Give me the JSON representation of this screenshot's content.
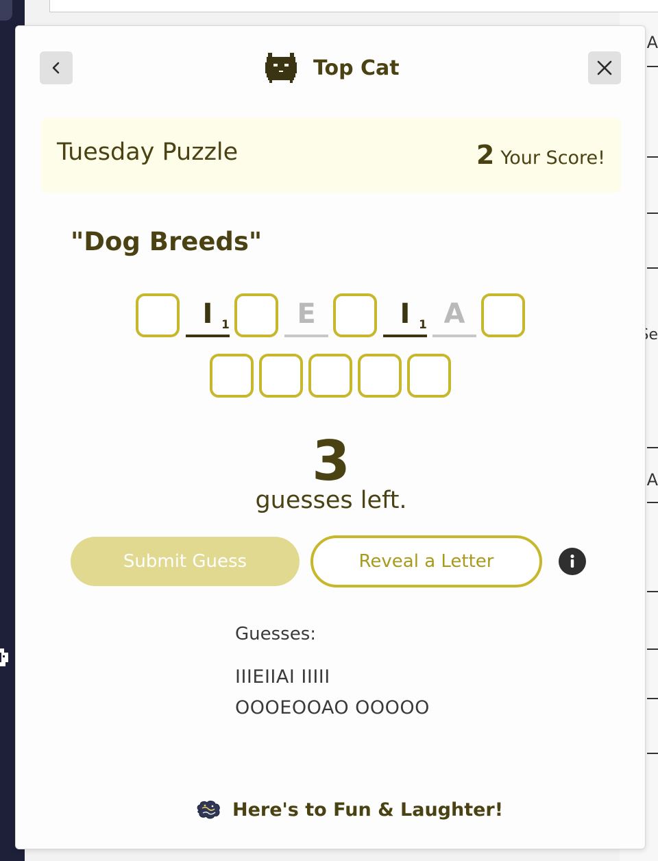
{
  "app": {
    "title": "Top Cat",
    "back_icon": "chevron-left-icon",
    "close_icon": "close-icon",
    "logo_icon": "pixel-cat-icon"
  },
  "puzzle": {
    "day": "Tuesday Puzzle",
    "score_value": "2",
    "score_label": "Your Score!",
    "category": "\"Dog Breeds\""
  },
  "board": {
    "word1": [
      {
        "letter": "",
        "sub": "",
        "state": "empty"
      },
      {
        "letter": "I",
        "sub": "1",
        "state": "dark"
      },
      {
        "letter": "",
        "sub": "",
        "state": "empty"
      },
      {
        "letter": "E",
        "sub": "",
        "state": "gray"
      },
      {
        "letter": "",
        "sub": "",
        "state": "empty"
      },
      {
        "letter": "I",
        "sub": "1",
        "state": "dark"
      },
      {
        "letter": "A",
        "sub": "",
        "state": "gray"
      },
      {
        "letter": "",
        "sub": "",
        "state": "empty"
      }
    ],
    "word2": [
      {
        "letter": "",
        "sub": "",
        "state": "empty"
      },
      {
        "letter": "",
        "sub": "",
        "state": "empty"
      },
      {
        "letter": "",
        "sub": "",
        "state": "empty"
      },
      {
        "letter": "",
        "sub": "",
        "state": "empty"
      },
      {
        "letter": "",
        "sub": "",
        "state": "empty"
      }
    ]
  },
  "status": {
    "guesses_left_count": "3",
    "guesses_left_label": "guesses left."
  },
  "actions": {
    "submit_label": "Submit Guess",
    "reveal_label": "Reveal a Letter",
    "info_icon": "info-icon"
  },
  "history": {
    "heading": "Guesses:",
    "items": [
      "IIIEIIAI IIIII",
      "OOOEOOAO OOOOO"
    ]
  },
  "footer": {
    "text": "Here's to Fun & Laughter!",
    "icon": "brain-icon"
  },
  "colors": {
    "brand": "#4a4213",
    "tile_border": "#c7b72c",
    "submit_bg": "#e1d98f",
    "banner_bg": "#fefde9",
    "gray_letter": "#b9b9b9"
  },
  "background": {
    "right_fragments": [
      "A",
      "Se",
      "A"
    ]
  }
}
